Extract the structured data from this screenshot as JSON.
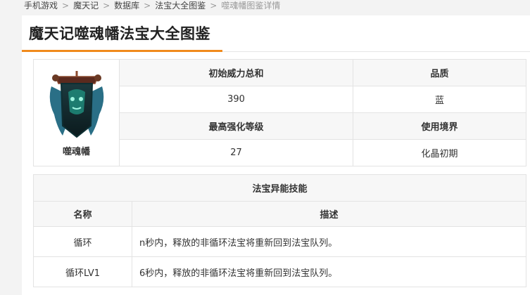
{
  "breadcrumb": {
    "items": [
      "手机游戏",
      "魔天记",
      "数据库",
      "法宝大全图鉴"
    ],
    "separator": ">",
    "current": "噬魂幡图鉴详情"
  },
  "page": {
    "title": "魔天记噬魂幡法宝大全图鉴",
    "accent_color": "#f08a1c"
  },
  "item": {
    "name": "噬魂幡",
    "image_icon": "soul-banner-icon"
  },
  "stats": {
    "power_label": "初始威力总和",
    "power_value": "390",
    "quality_label": "品质",
    "quality_value": "蓝",
    "max_level_label": "最高强化等级",
    "max_level_value": "27",
    "realm_label": "使用境界",
    "realm_value": "化晶初期"
  },
  "skills": {
    "section_title": "法宝异能技能",
    "col_name": "名称",
    "col_desc": "描述",
    "rows": [
      {
        "name": "循环",
        "desc": "n秒内，释放的非循环法宝将重新回到法宝队列。"
      },
      {
        "name": "循环LV1",
        "desc": "6秒内，释放的非循环法宝将重新回到法宝队列。"
      }
    ]
  }
}
